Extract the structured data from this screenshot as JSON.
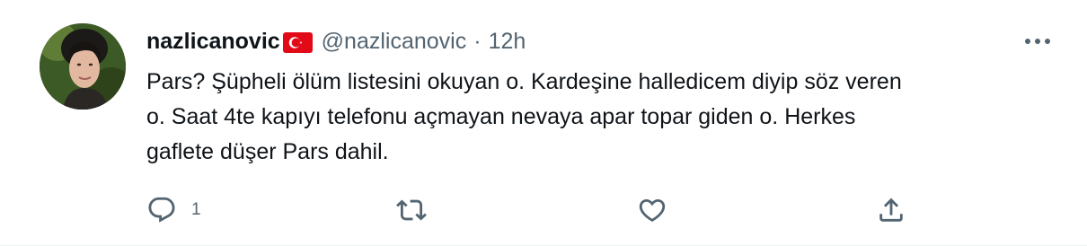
{
  "tweet": {
    "display_name": "nazlicanovic",
    "handle": "@nazlicanovic",
    "separator": "·",
    "time": "12h",
    "flag_emoji": "turkey-flag",
    "text": "Pars? Şüpheli ölüm listesini okuyan o. Kardeşine halledicem diyip söz veren o. Saat 4te kapıyı telefonu açmayan nevaya apar topar giden o. Herkes gaflete düşer Pars dahil.",
    "text_lines": [
      "Pars? Şüpheli ölüm listesini okuyan o. Kardeşine halledicem diyip söz veren",
      "o. Saat 4te kapıyı telefonu açmayan nevaya apar topar giden o. Herkes",
      "gaflete düşer Pars dahil."
    ],
    "reply_count": "1",
    "retweet_count": "",
    "like_count": ""
  },
  "icons": {
    "reply": "reply-icon",
    "retweet": "retweet-icon",
    "like": "like-icon",
    "share": "share-icon",
    "more": "more-icon"
  },
  "colors": {
    "text": "#0f1419",
    "secondary": "#536471",
    "flag_red": "#e30a17"
  }
}
